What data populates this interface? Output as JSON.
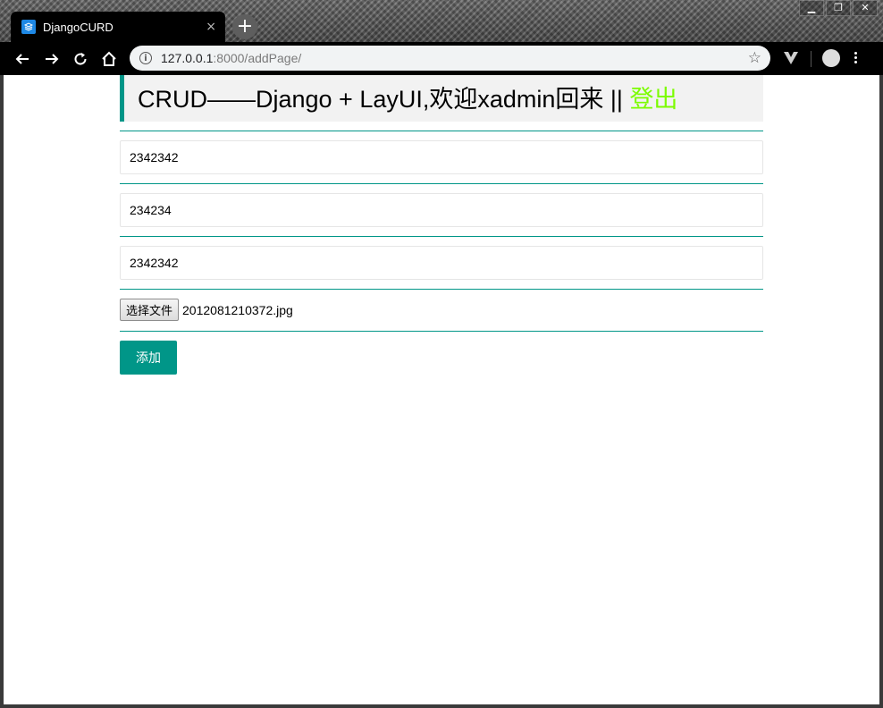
{
  "browser": {
    "tab_title": "DjangoCURD",
    "tab_close": "×",
    "new_tab": "+",
    "url_host": "127.0.0.1",
    "url_path": ":8000/addPage/",
    "window_controls": [
      "▁",
      "❐",
      "✕"
    ]
  },
  "page": {
    "header_text": "CRUD——Django + LayUI,欢迎xadmin回来 || ",
    "logout_label": "登出",
    "fields": [
      {
        "value": "2342342"
      },
      {
        "value": "234234"
      },
      {
        "value": "2342342"
      }
    ],
    "file_button_label": "选择文件",
    "file_name": "2012081210372.jpg",
    "submit_label": "添加"
  },
  "colors": {
    "accent": "#009688",
    "logout": "#7cfc00",
    "header_bg": "#f2f2f2"
  }
}
